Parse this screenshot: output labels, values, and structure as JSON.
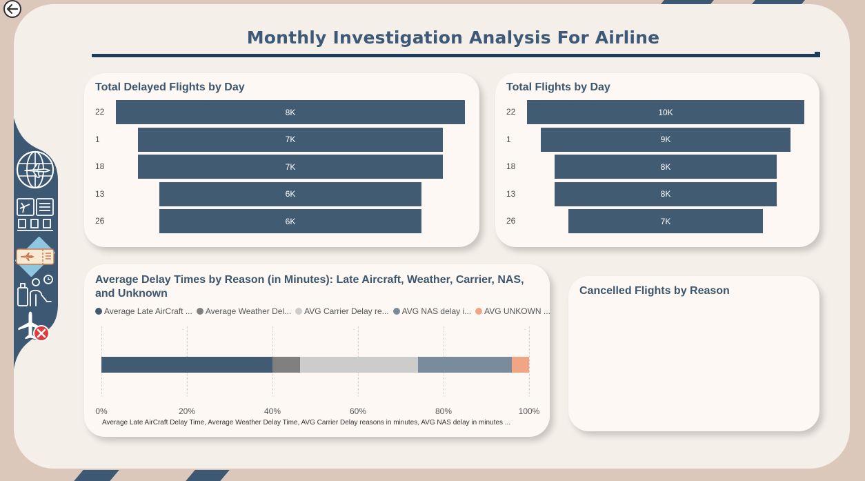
{
  "header": {
    "title": "Monthly Investigation Analysis For Airline"
  },
  "colors": {
    "accent": "#415b72",
    "frame": "#f5efe9",
    "background": "#dcc8bb",
    "card": "#fdf8f4"
  },
  "nav": {
    "back_icon": "back-arrow-icon",
    "items": [
      {
        "name": "nav-globe-flight",
        "icon": "globe-airplane-icon"
      },
      {
        "name": "nav-airport-board",
        "icon": "airport-board-icon"
      },
      {
        "name": "nav-boarding-pass",
        "icon": "boarding-pass-icon"
      },
      {
        "name": "nav-traveler",
        "icon": "traveler-waiting-icon"
      },
      {
        "name": "nav-cancelled",
        "icon": "cancelled-flight-icon"
      }
    ]
  },
  "cards": {
    "delayed_by_day": {
      "title": "Total Delayed Flights by Day"
    },
    "total_by_day": {
      "title": "Total Flights by Day"
    },
    "avg_delay": {
      "title": "Average Delay Times by Reason (in Minutes): Late Aircraft, Weather, Carrier, NAS, and Unknown",
      "legend": [
        "Average Late AirCraft ...",
        "Average Weather Del...",
        "AVG Carrier Delay re...",
        "AVG NAS delay i...",
        "AVG UNKOWN ..."
      ],
      "axis_title": "Average Late AirCraft Delay Time, Average Weather Delay Time, AVG Carrier Delay reasons in minutes, AVG NAS delay in minutes ..."
    },
    "cancelled": {
      "title": "Cancelled Flights by Reason"
    }
  },
  "chart_data": [
    {
      "type": "bar",
      "title": "Total Delayed Flights by Day",
      "categories": [
        "22",
        "1",
        "18",
        "13",
        "26"
      ],
      "values": [
        8,
        7,
        7,
        6,
        6
      ],
      "labels": [
        "8K",
        "7K",
        "7K",
        "6K",
        "6K"
      ]
    },
    {
      "type": "bar",
      "title": "Total Flights by Day",
      "categories": [
        "22",
        "1",
        "18",
        "13",
        "26"
      ],
      "values": [
        10,
        9,
        8,
        8,
        7
      ],
      "labels": [
        "10K",
        "9K",
        "8K",
        "8K",
        "7K"
      ]
    },
    {
      "type": "bar",
      "title": "Average Delay Times by Reason (in Minutes): Late Aircraft, Weather, Carrier, NAS, and Unknown",
      "stacked": "100%",
      "series": [
        {
          "name": "Average Late AirCraft ...",
          "value": 40,
          "color": "#415b72"
        },
        {
          "name": "Average Weather Del...",
          "value": 6.5,
          "color": "#808080"
        },
        {
          "name": "AVG Carrier Delay re...",
          "value": 27.5,
          "color": "#cccccc"
        },
        {
          "name": "AVG NAS delay i...",
          "value": 22,
          "color": "#7a8c9c"
        },
        {
          "name": "AVG UNKOWN ...",
          "value": 4,
          "color": "#f0a584"
        }
      ],
      "ticks": [
        "0%",
        "20%",
        "40%",
        "60%",
        "80%",
        "100%"
      ],
      "xlim": [
        0,
        100
      ]
    }
  ]
}
